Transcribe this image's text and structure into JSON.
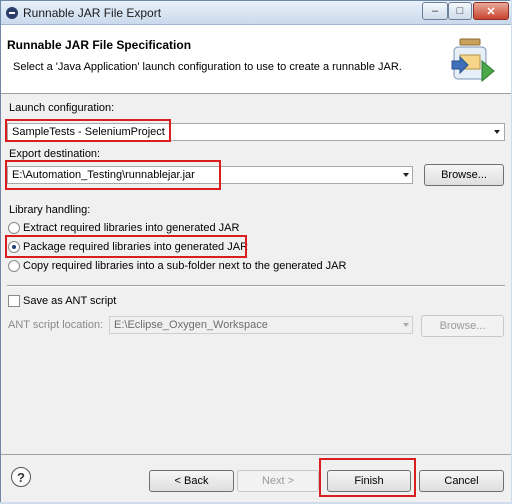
{
  "window": {
    "title": "Runnable JAR File Export",
    "controls": {
      "minimize": "‒",
      "maximize": "□",
      "close": "✕"
    }
  },
  "header": {
    "title": "Runnable JAR File Specification",
    "description": "Select a 'Java Application' launch configuration to use to create a runnable JAR."
  },
  "launch_configuration": {
    "label": "Launch configuration:",
    "value": "SampleTests - SeleniumProject"
  },
  "export_destination": {
    "label": "Export destination:",
    "value": "E:\\Automation_Testing\\runnablejar.jar",
    "browse_label": "Browse..."
  },
  "library_handling": {
    "label": "Library handling:",
    "options": [
      {
        "label": "Extract required libraries into generated JAR",
        "selected": false
      },
      {
        "label": "Package required libraries into generated JAR",
        "selected": true
      },
      {
        "label": "Copy required libraries into a sub-folder next to the generated JAR",
        "selected": false
      }
    ]
  },
  "ant": {
    "save_label": "Save as ANT script",
    "checked": false,
    "location_label": "ANT script location:",
    "location_value": "E:\\Eclipse_Oxygen_Workspace",
    "browse_label": "Browse..."
  },
  "footer": {
    "help_glyph": "?",
    "back_label": "< Back",
    "next_label": "Next >",
    "finish_label": "Finish",
    "cancel_label": "Cancel"
  },
  "colors": {
    "highlight": "#d81e1e",
    "radio_dot": "#1e3d77"
  }
}
